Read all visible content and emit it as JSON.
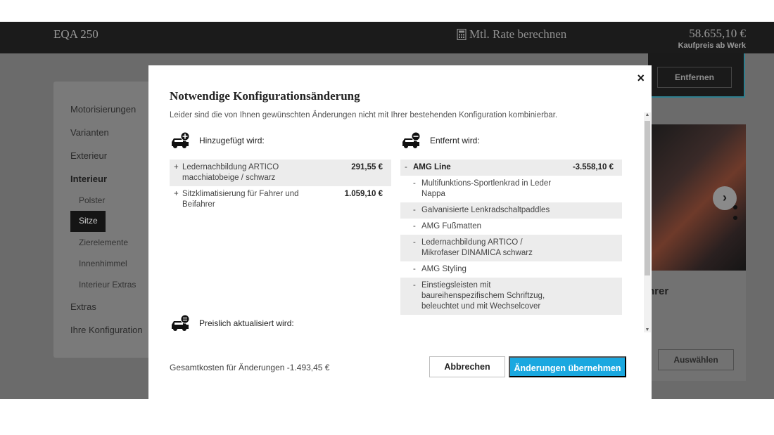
{
  "topbar": {
    "model": "EQA 250",
    "calc_label": "Mtl. Rate berechnen",
    "price": "58.655,10 €",
    "price_caption": "Kaufpreis ab Werk"
  },
  "sidebar": {
    "items": [
      {
        "label": "Motorisierungen"
      },
      {
        "label": "Varianten"
      },
      {
        "label": "Exterieur"
      },
      {
        "label": "Interieur"
      },
      {
        "label": "Polster"
      },
      {
        "label": "Sitze"
      },
      {
        "label": "Zierelemente"
      },
      {
        "label": "Innenhimmel"
      },
      {
        "label": "Interieur Extras"
      },
      {
        "label": "Extras"
      },
      {
        "label": "Ihre Konfiguration"
      }
    ]
  },
  "background": {
    "remove_button": "Entfernen",
    "card_title_fragment": "hrer",
    "select_button": "Auswählen"
  },
  "modal": {
    "title": "Notwendige Konfigurationsänderung",
    "subtitle": "Leider sind die von Ihnen gewünschten Änderungen nicht mit Ihrer bestehenden Konfiguration kombinierbar.",
    "added_heading": "Hinzugefügt wird:",
    "removed_heading": "Entfernt wird:",
    "price_heading": "Preislich aktualisiert wird:",
    "added": [
      {
        "sign": "+",
        "label": "Ledernachbildung ARTICO macchiatobeige / schwarz",
        "price": "291,55 €"
      },
      {
        "sign": "+",
        "label": "Sitzklimatisierung für Fahrer und Beifahrer",
        "price": "1.059,10 €"
      }
    ],
    "removed_group": {
      "sign": "-",
      "label": "AMG Line",
      "price": "-3.558,10 €"
    },
    "removed_items": [
      {
        "sign": "-",
        "label": "Multifunktions-Sportlenkrad in Leder Nappa"
      },
      {
        "sign": "-",
        "label": "Galvanisierte Lenkradschaltpaddles"
      },
      {
        "sign": "-",
        "label": "AMG Fußmatten"
      },
      {
        "sign": "-",
        "label": "Ledernachbildung ARTICO / Mikrofaser DINAMICA schwarz"
      },
      {
        "sign": "-",
        "label": "AMG Styling"
      },
      {
        "sign": "-",
        "label": "Einstiegsleisten mit baureihenspezifischem Schriftzug, beleuchtet und mit Wechselcover"
      }
    ],
    "total": "Gesamtkosten für Änderungen -1.493,45 €",
    "cancel_label": "Abbrechen",
    "apply_label": "Änderungen übernehmen",
    "close_icon": "×"
  },
  "colors": {
    "accent": "#1aa8e0",
    "overlay": "#6b6b6b",
    "topbar": "#1b1b1b"
  }
}
